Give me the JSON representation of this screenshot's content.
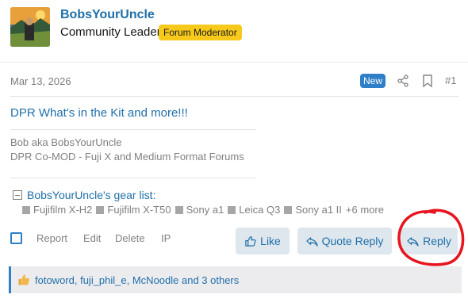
{
  "user": {
    "name": "BobsYourUncle",
    "title": "Community Leader",
    "badge": "Forum Moderator"
  },
  "post": {
    "date": "Mar 13, 2026",
    "new_badge": "New",
    "number": "#1",
    "title": "DPR What's in the Kit and more!!!",
    "signature": [
      "Bob aka BobsYourUncle",
      "DPR Co-MOD - Fuji X and Medium Format Forums"
    ],
    "gear_header": "BobsYourUncle's gear list:",
    "gear_items": [
      "Fujifilm X-H2",
      "Fujifilm X-T50",
      "Sony a1",
      "Leica Q3",
      "Sony a1 II"
    ],
    "gear_more": "+6 more"
  },
  "actions": {
    "report": "Report",
    "edit": "Edit",
    "delete": "Delete",
    "ip": "IP",
    "like": "Like",
    "quote_reply": "Quote Reply",
    "reply": "Reply"
  },
  "likes": {
    "text": "fotoword, fuji_phil_e, McNoodle and 3 others"
  },
  "colors": {
    "link": "#1f6fa8",
    "accent": "#2e7fc7",
    "badge": "#f6c91a",
    "annotation": "#e8141e"
  },
  "icons": [
    "share-icon",
    "bookmark-icon",
    "thumbs-up-icon",
    "quote-reply-icon",
    "reply-icon"
  ]
}
